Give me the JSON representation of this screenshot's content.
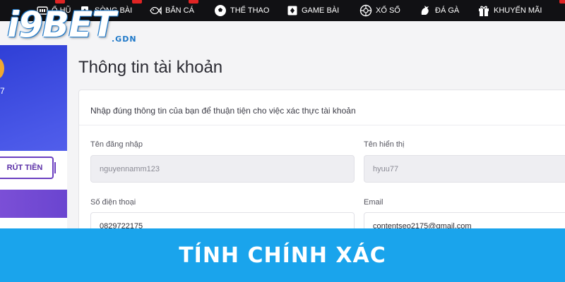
{
  "brand": {
    "logo_main": "i9BET",
    "logo_sub": ".GDN"
  },
  "nav": {
    "items": [
      {
        "label": "Ổ HŨ",
        "icon": "slot-icon",
        "badge": true
      },
      {
        "label": "SÒNG BÀI",
        "icon": "cards-icon",
        "badge": true
      },
      {
        "label": "BẮN CÁ",
        "icon": "fish-icon",
        "badge": true
      },
      {
        "label": "THỂ THAO",
        "icon": "soccer-ball-icon",
        "badge": false
      },
      {
        "label": "GAME BÀI",
        "icon": "card-game-icon",
        "badge": false
      },
      {
        "label": "XỔ SỐ",
        "icon": "lottery-icon",
        "badge": false
      },
      {
        "label": "ĐÁ GÀ",
        "icon": "rooster-icon",
        "badge": false
      },
      {
        "label": "KHUYẾN MÃI",
        "icon": "gift-icon",
        "badge": true
      }
    ]
  },
  "sidebar": {
    "number_fragment": "7",
    "withdraw_label": "RÚT TIỀN"
  },
  "main": {
    "title": "Thông tin tài khoản",
    "description": "Nhập đúng thông tin của bạn để thuận tiện cho việc xác thực tài khoản",
    "fields": {
      "username": {
        "label": "Tên đăng nhập",
        "value": "nguyennamm123"
      },
      "display_name": {
        "label": "Tên hiển thị",
        "value": "hyuu77"
      },
      "phone": {
        "label": "Số điện thoại",
        "value": "0829722175"
      },
      "email": {
        "label": "Email",
        "value": "contentseo2175@gmail.com"
      }
    }
  },
  "banner": {
    "text": "TÍNH CHÍNH XÁC"
  },
  "colors": {
    "nav_bg": "#111114",
    "sidebar_blue": "#3a48e0",
    "accent_purple": "#6b3fc0",
    "banner": "#1aa4ec",
    "logo_blue": "#1e78c8"
  }
}
